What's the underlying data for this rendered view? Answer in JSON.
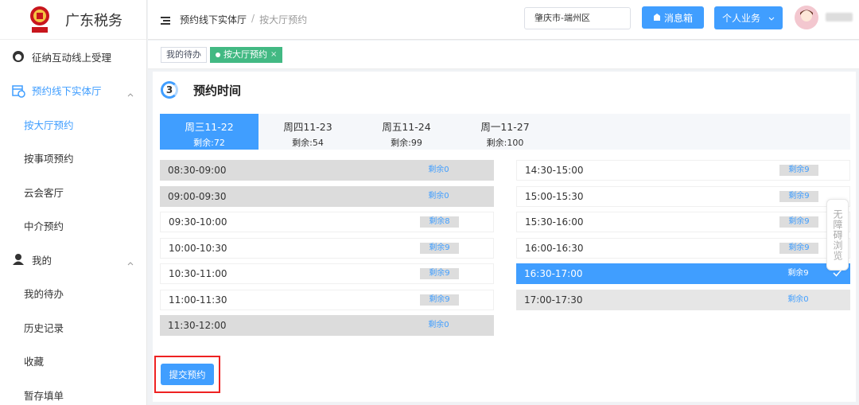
{
  "brand": {
    "title": "广东税务",
    "seal_text": "中国税务"
  },
  "sidebar": {
    "items": [
      {
        "label": "征纳互动线上受理"
      },
      {
        "label": "预约线下实体厅"
      },
      {
        "label": "按大厅预约"
      },
      {
        "label": "按事项预约"
      },
      {
        "label": "云会客厅"
      },
      {
        "label": "中介预约"
      },
      {
        "label": "我的"
      },
      {
        "label": "我的待办"
      },
      {
        "label": "历史记录"
      },
      {
        "label": "收藏"
      },
      {
        "label": "暂存填单"
      }
    ]
  },
  "header": {
    "breadcrumb": [
      "预约线下实体厅",
      "/",
      "按大厅预约"
    ],
    "region": "肇庆市-端州区",
    "messages_label": "消息箱",
    "business_label": "个人业务"
  },
  "tags": {
    "todo": "我的待办",
    "current": "按大厅预约",
    "close": "×"
  },
  "step": {
    "number": "3",
    "title": "预约时间"
  },
  "dates": [
    {
      "day": "周三11-22",
      "remain": "剩余:72"
    },
    {
      "day": "周四11-23",
      "remain": "剩余:54"
    },
    {
      "day": "周五11-24",
      "remain": "剩余:99"
    },
    {
      "day": "周一11-27",
      "remain": "剩余:100"
    }
  ],
  "slots_left": [
    {
      "time": "08:30-09:00",
      "remain": "剩余0"
    },
    {
      "time": "09:00-09:30",
      "remain": "剩余0"
    },
    {
      "time": "09:30-10:00",
      "remain": "剩余8"
    },
    {
      "time": "10:00-10:30",
      "remain": "剩余9"
    },
    {
      "time": "10:30-11:00",
      "remain": "剩余9"
    },
    {
      "time": "11:00-11:30",
      "remain": "剩余9"
    },
    {
      "time": "11:30-12:00",
      "remain": "剩余0"
    }
  ],
  "slots_right": [
    {
      "time": "14:30-15:00",
      "remain": "剩余9"
    },
    {
      "time": "15:00-15:30",
      "remain": "剩余9"
    },
    {
      "time": "15:30-16:00",
      "remain": "剩余9"
    },
    {
      "time": "16:00-16:30",
      "remain": "剩余9"
    },
    {
      "time": "16:30-17:00",
      "remain": "剩余9"
    },
    {
      "time": "17:00-17:30",
      "remain": "剩余0"
    }
  ],
  "submit_label": "提交预约",
  "accessibility_label": "无障碍浏览",
  "colors": {
    "primary": "#409eff",
    "tag_green": "#42b983",
    "highlight_red": "#e22222"
  }
}
